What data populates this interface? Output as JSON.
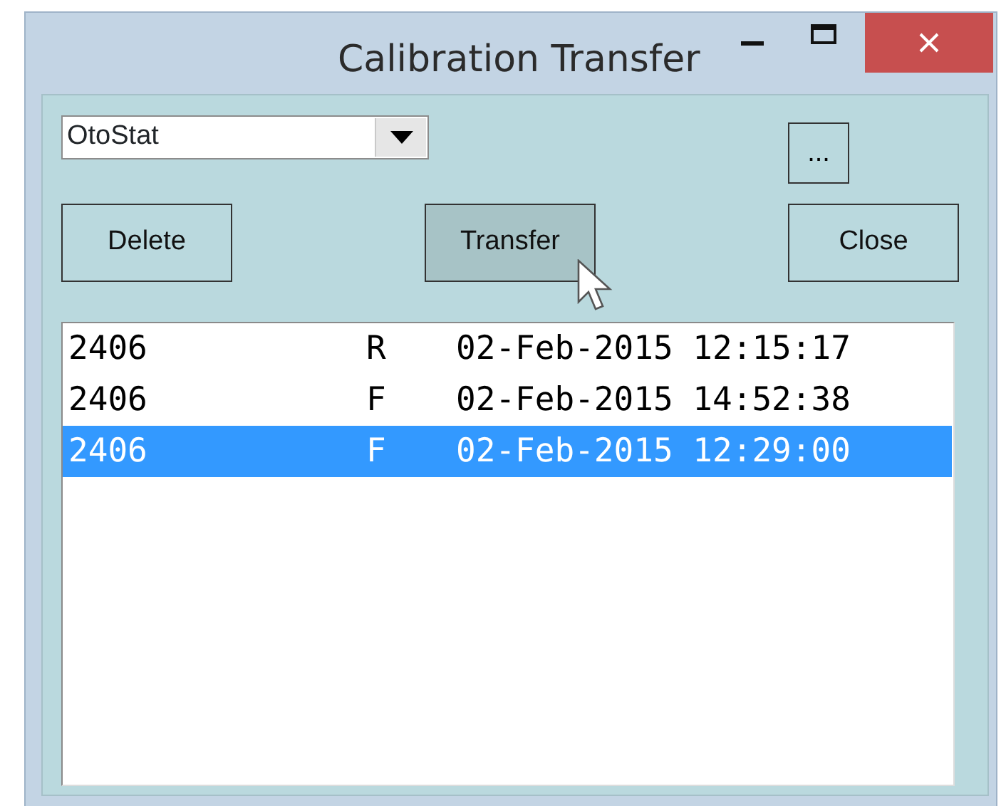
{
  "window": {
    "title": "Calibration Transfer"
  },
  "device_select": {
    "value": "OtoStat"
  },
  "browse_button": {
    "label": "..."
  },
  "buttons": [
    {
      "label": "Delete",
      "hovered": false
    },
    {
      "label": "Transfer",
      "hovered": true
    },
    {
      "label": "Close",
      "hovered": false
    }
  ],
  "records": [
    {
      "id": "2406",
      "type": "R",
      "timestamp": "02-Feb-2015 12:15:17",
      "selected": false
    },
    {
      "id": "2406",
      "type": "F",
      "timestamp": "02-Feb-2015 14:52:38",
      "selected": false
    },
    {
      "id": "2406",
      "type": "F",
      "timestamp": "02-Feb-2015 12:29:00",
      "selected": true
    }
  ]
}
